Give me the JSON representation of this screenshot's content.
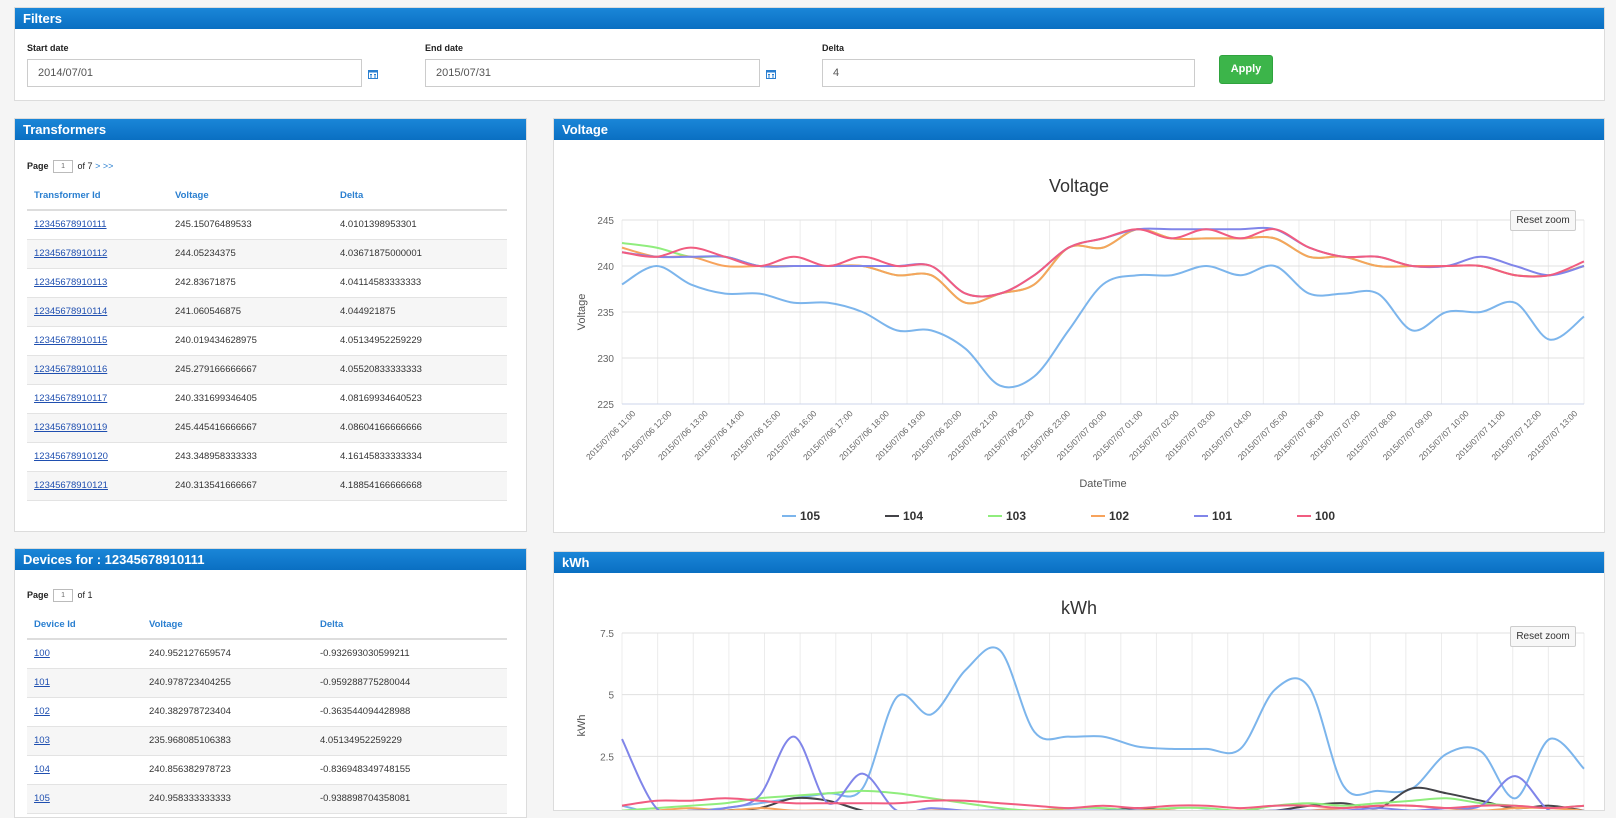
{
  "filters": {
    "title": "Filters",
    "start_label": "Start date",
    "start_value": "2014/07/01",
    "end_label": "End date",
    "end_value": "2015/07/31",
    "delta_label": "Delta",
    "delta_value": "4",
    "apply_label": "Apply"
  },
  "transformers": {
    "title": "Transformers",
    "page_label": "Page",
    "page_value": "1",
    "of_label": "of 7",
    "next": ">",
    "last": ">>",
    "columns": [
      "Transformer Id",
      "Voltage",
      "Delta"
    ],
    "rows": [
      [
        "12345678910111",
        "245.15076489533",
        "4.0101398953301"
      ],
      [
        "12345678910112",
        "244.05234375",
        "4.03671875000001"
      ],
      [
        "12345678910113",
        "242.83671875",
        "4.04114583333333"
      ],
      [
        "12345678910114",
        "241.060546875",
        "4.044921875"
      ],
      [
        "12345678910115",
        "240.019434628975",
        "4.05134952259229"
      ],
      [
        "12345678910116",
        "245.279166666667",
        "4.05520833333333"
      ],
      [
        "12345678910117",
        "240.331699346405",
        "4.08169934640523"
      ],
      [
        "12345678910119",
        "245.445416666667",
        "4.08604166666666"
      ],
      [
        "12345678910120",
        "243.348958333333",
        "4.16145833333334"
      ],
      [
        "12345678910121",
        "240.313541666667",
        "4.18854166666668"
      ]
    ]
  },
  "devices": {
    "title": "Devices for : 12345678910111",
    "page_label": "Page",
    "page_value": "1",
    "of_label": "of 1",
    "columns": [
      "Device Id",
      "Voltage",
      "Delta"
    ],
    "rows": [
      [
        "100",
        "240.952127659574",
        "-0.932693030599211"
      ],
      [
        "101",
        "240.978723404255",
        "-0.959288775280044"
      ],
      [
        "102",
        "240.382978723404",
        "-0.363544094428988"
      ],
      [
        "103",
        "235.968085106383",
        "4.05134952259229"
      ],
      [
        "104",
        "240.856382978723",
        "-0.836948349748155"
      ],
      [
        "105",
        "240.958333333333",
        "-0.938898704358081"
      ]
    ]
  },
  "voltage_panel": {
    "title": "Voltage",
    "reset_zoom": "Reset zoom"
  },
  "kwh_panel": {
    "title": "kWh",
    "reset_zoom": "Reset zoom"
  },
  "colors": {
    "header": "#0a6fc2",
    "apply": "#3cb54a",
    "s105": "#7cb5ec",
    "s104": "#434348",
    "s103": "#90ed7d",
    "s102": "#f7a35c",
    "s101": "#8085e9",
    "s100": "#f15c80"
  },
  "chart_data": [
    {
      "type": "line",
      "title": "Voltage",
      "xlabel": "DateTime",
      "ylabel": "Voltage",
      "ylim": [
        225,
        245
      ],
      "yticks": [
        "225",
        "230",
        "235",
        "240",
        "245"
      ],
      "grid": true,
      "legend": "bottom",
      "x": [
        "2015/07/06 11:00",
        "2015/07/06 12:00",
        "2015/07/06 13:00",
        "2015/07/06 14:00",
        "2015/07/06 15:00",
        "2015/07/06 16:00",
        "2015/07/06 17:00",
        "2015/07/06 18:00",
        "2015/07/06 19:00",
        "2015/07/06 20:00",
        "2015/07/06 21:00",
        "2015/07/06 22:00",
        "2015/07/06 23:00",
        "2015/07/07 00:00",
        "2015/07/07 01:00",
        "2015/07/07 02:00",
        "2015/07/07 03:00",
        "2015/07/07 04:00",
        "2015/07/07 05:00",
        "2015/07/07 06:00",
        "2015/07/07 07:00",
        "2015/07/07 08:00",
        "2015/07/07 09:00",
        "2015/07/07 10:00",
        "2015/07/07 11:00",
        "2015/07/07 12:00",
        "2015/07/07 13:00"
      ],
      "series": [
        {
          "name": "105",
          "color": "#7cb5ec",
          "values": [
            238,
            240,
            238,
            237,
            237,
            236,
            236,
            235,
            233,
            233,
            231,
            227,
            228,
            233,
            238,
            239,
            239,
            240,
            239,
            240,
            237,
            237,
            237,
            233,
            235,
            235,
            236,
            232,
            234.5
          ]
        },
        {
          "name": "104",
          "color": "#434348",
          "values": []
        },
        {
          "name": "103",
          "color": "#90ed7d",
          "values": [
            242.5,
            242,
            241,
            241,
            240,
            240,
            240,
            240,
            239,
            239,
            236,
            237,
            238,
            242,
            242,
            244,
            243,
            243,
            243,
            243,
            241,
            241,
            240,
            240,
            240,
            240,
            239,
            239,
            240
          ]
        },
        {
          "name": "102",
          "color": "#f7a35c",
          "values": [
            242,
            241,
            241,
            240,
            240,
            240,
            240,
            240,
            239,
            239,
            236,
            237,
            238,
            242,
            242,
            244,
            243,
            243,
            243,
            243,
            241,
            241,
            240,
            240,
            240,
            240,
            239,
            239,
            240
          ]
        },
        {
          "name": "101",
          "color": "#8085e9",
          "values": [
            241.5,
            241,
            241,
            241,
            240,
            240,
            240,
            240,
            240,
            240,
            237,
            237,
            239,
            242,
            243,
            244,
            244,
            244,
            244,
            244,
            242,
            241,
            241,
            240,
            240,
            241,
            240,
            239,
            240
          ]
        },
        {
          "name": "100",
          "color": "#f15c80",
          "values": [
            241.5,
            241,
            242,
            241,
            240,
            241,
            240,
            241,
            240,
            240,
            237,
            237,
            239,
            242,
            243,
            244,
            243,
            244,
            243,
            244,
            242,
            241,
            241,
            240,
            240,
            240,
            239,
            239,
            240.5
          ]
        }
      ]
    },
    {
      "type": "line",
      "title": "kWh",
      "xlabel": "",
      "ylabel": "kWh",
      "ylim": [
        0,
        7.5
      ],
      "yticks": [
        "2.5",
        "5",
        "7.5"
      ],
      "grid": true,
      "series": [
        {
          "name": "105",
          "color": "#7cb5ec",
          "values": [
            0.5,
            0.2,
            0.3,
            0.4,
            0.6,
            0.8,
            1.0,
            1.2,
            4.9,
            4.2,
            6.0,
            6.8,
            3.5,
            3.3,
            3.3,
            2.9,
            2.8,
            2.8,
            2.8,
            5.2,
            5.3,
            1.3,
            1.1,
            1.2,
            2.6,
            2.7,
            0.8,
            3.2,
            2.0
          ]
        },
        {
          "name": "104",
          "color": "#434348",
          "values": [
            0.1,
            0.0,
            0.1,
            0.3,
            0.4,
            0.8,
            0.7,
            0.3,
            0.1,
            0.2,
            0.2,
            0.3,
            0.2,
            0.3,
            0.3,
            0.4,
            0.3,
            0.2,
            0.3,
            0.3,
            0.5,
            0.6,
            0.4,
            1.2,
            1.0,
            0.7,
            0.4,
            0.5,
            0.3
          ]
        },
        {
          "name": "103",
          "color": "#90ed7d",
          "values": [
            0.3,
            0.4,
            0.5,
            0.6,
            0.8,
            0.9,
            1.0,
            1.1,
            1.0,
            0.8,
            0.6,
            0.4,
            0.3,
            0.4,
            0.4,
            0.3,
            0.4,
            0.4,
            0.3,
            0.5,
            0.6,
            0.5,
            0.6,
            0.7,
            0.8,
            0.6,
            0.5,
            0.4,
            0.5
          ]
        },
        {
          "name": "102",
          "color": "#f7a35c",
          "values": [
            0.2,
            0.3,
            0.4,
            0.3,
            0.4,
            0.3,
            0.3,
            0.2,
            0.2,
            0.3,
            0.3,
            0.2,
            0.3,
            0.3,
            0.2,
            0.3,
            0.3,
            0.2,
            0.3,
            0.2,
            0.3,
            0.4,
            0.5,
            0.5,
            0.4,
            0.3,
            0.4,
            0.4,
            0.3
          ]
        },
        {
          "name": "101",
          "color": "#8085e9",
          "values": [
            3.2,
            0.4,
            0.3,
            0.4,
            0.9,
            3.3,
            0.6,
            1.8,
            0.3,
            0.4,
            0.3,
            0.3,
            0.2,
            0.3,
            0.3,
            0.3,
            0.2,
            0.3,
            0.2,
            0.3,
            0.3,
            0.3,
            0.4,
            0.3,
            0.4,
            0.5,
            1.7,
            0.3,
            0.3
          ]
        },
        {
          "name": "100",
          "color": "#f15c80",
          "values": [
            0.5,
            0.7,
            0.7,
            0.8,
            0.7,
            0.6,
            0.6,
            0.6,
            0.6,
            0.7,
            0.7,
            0.6,
            0.5,
            0.4,
            0.5,
            0.4,
            0.5,
            0.5,
            0.4,
            0.5,
            0.5,
            0.4,
            0.5,
            0.5,
            0.4,
            0.5,
            0.5,
            0.4,
            0.5
          ]
        }
      ]
    }
  ]
}
